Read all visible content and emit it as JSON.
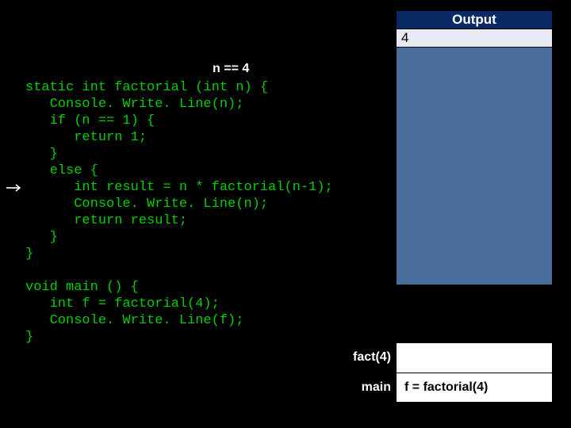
{
  "annotation": "n == 4",
  "code_lines": [
    "static int factorial (int n) {",
    "   Console. Write. Line(n);",
    "   if (n == 1) {",
    "      return 1;",
    "   }",
    "   else {",
    "      int result = n * factorial(n-1);",
    "      Console. Write. Line(n);",
    "      return result;",
    "   }",
    "}",
    "",
    "void main () {",
    "   int f = factorial(4);",
    "   Console. Write. Line(f);",
    "}"
  ],
  "output": {
    "title": "Output",
    "rows": [
      "4"
    ]
  },
  "stack": [
    {
      "label": "fact(4)",
      "cell": ""
    },
    {
      "label": "main",
      "cell": "f = factorial(4)"
    }
  ],
  "current_line_index": 6
}
